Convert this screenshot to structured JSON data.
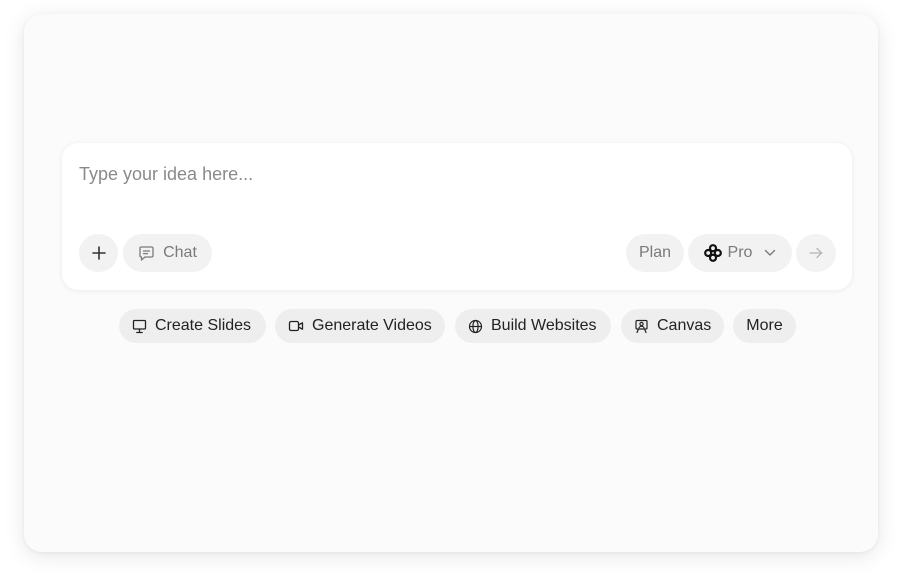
{
  "composer": {
    "placeholder": "Type your idea here...",
    "value": "",
    "add_icon": "plus-icon",
    "chat_label": "Chat",
    "chat_icon": "message-square-icon",
    "plan_label": "Plan",
    "model_label": "Pro",
    "model_icon": "flower-logo-icon",
    "send_icon": "arrow-right-icon"
  },
  "suggestions": [
    {
      "label": "Create Slides",
      "icon": "presentation-icon"
    },
    {
      "label": "Generate Videos",
      "icon": "video-icon"
    },
    {
      "label": "Build Websites",
      "icon": "globe-icon"
    },
    {
      "label": "Canvas",
      "icon": "easel-icon"
    },
    {
      "label": "More",
      "icon": ""
    }
  ],
  "colors": {
    "background": "#fbfbfb",
    "composer": "#ffffff",
    "pill": "#f2f2f2",
    "chip": "#eeeeee",
    "muted_text": "#7a7a7a",
    "text": "#222222"
  }
}
